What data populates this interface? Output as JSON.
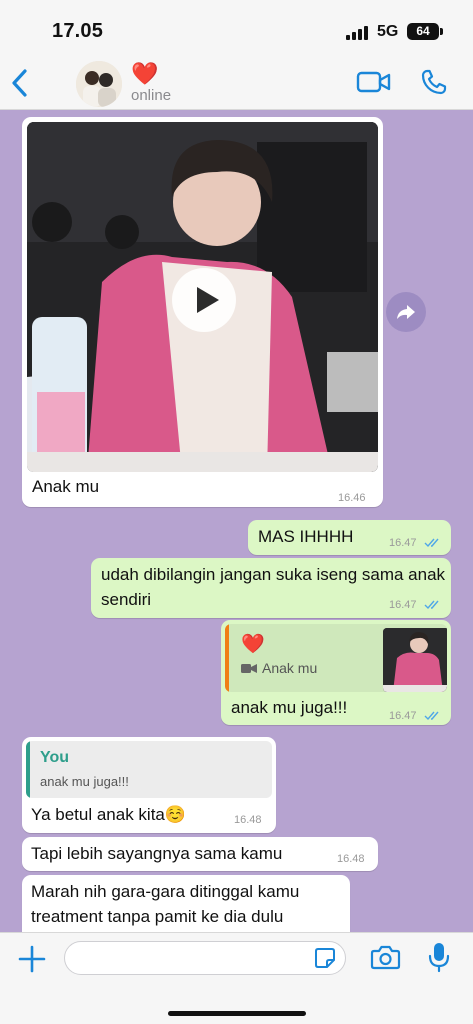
{
  "status_bar": {
    "time": "17.05",
    "network": "5G",
    "battery": "64"
  },
  "header": {
    "contact_name": "❤️",
    "status": "online",
    "icons": {
      "back": "chevron-left-icon",
      "video": "video-call-icon",
      "call": "phone-icon"
    },
    "accent_color": "#1a86d8"
  },
  "messages": [
    {
      "direction": "incoming",
      "media": "video",
      "text": "Anak mu",
      "time": "16.46"
    },
    {
      "direction": "outgoing",
      "text": "MAS IHHHH",
      "time": "16.47",
      "read": true
    },
    {
      "direction": "outgoing",
      "text": "udah dibilangin jangan suka iseng sama anak sendiri",
      "time": "16.47",
      "read": true
    },
    {
      "direction": "outgoing",
      "reply_to": {
        "sender": "❤️",
        "text": "Anak mu",
        "media": "video"
      },
      "text": "anak mu juga!!!",
      "time": "16.47",
      "read": true
    },
    {
      "direction": "incoming",
      "reply_to": {
        "sender": "You",
        "text": "anak mu juga!!!"
      },
      "text": "Ya betul anak kita☺️",
      "time": "16.48"
    },
    {
      "direction": "incoming",
      "text": "Tapi lebih sayangnya sama kamu",
      "time": "16.48"
    },
    {
      "direction": "incoming",
      "text": "Marah nih gara-gara ditinggal kamu treatment tanpa pamit ke dia dulu",
      "time": ""
    }
  ],
  "input_bar": {
    "placeholder": ""
  },
  "colors": {
    "chat_background": "#b6a3d0",
    "outgoing_bubble": "#dcf7c5",
    "incoming_bubble": "#ffffff",
    "read_ticks": "#4fa7e8",
    "quote_you": "#2e9e8b",
    "quote_contact": "#f07e14"
  }
}
